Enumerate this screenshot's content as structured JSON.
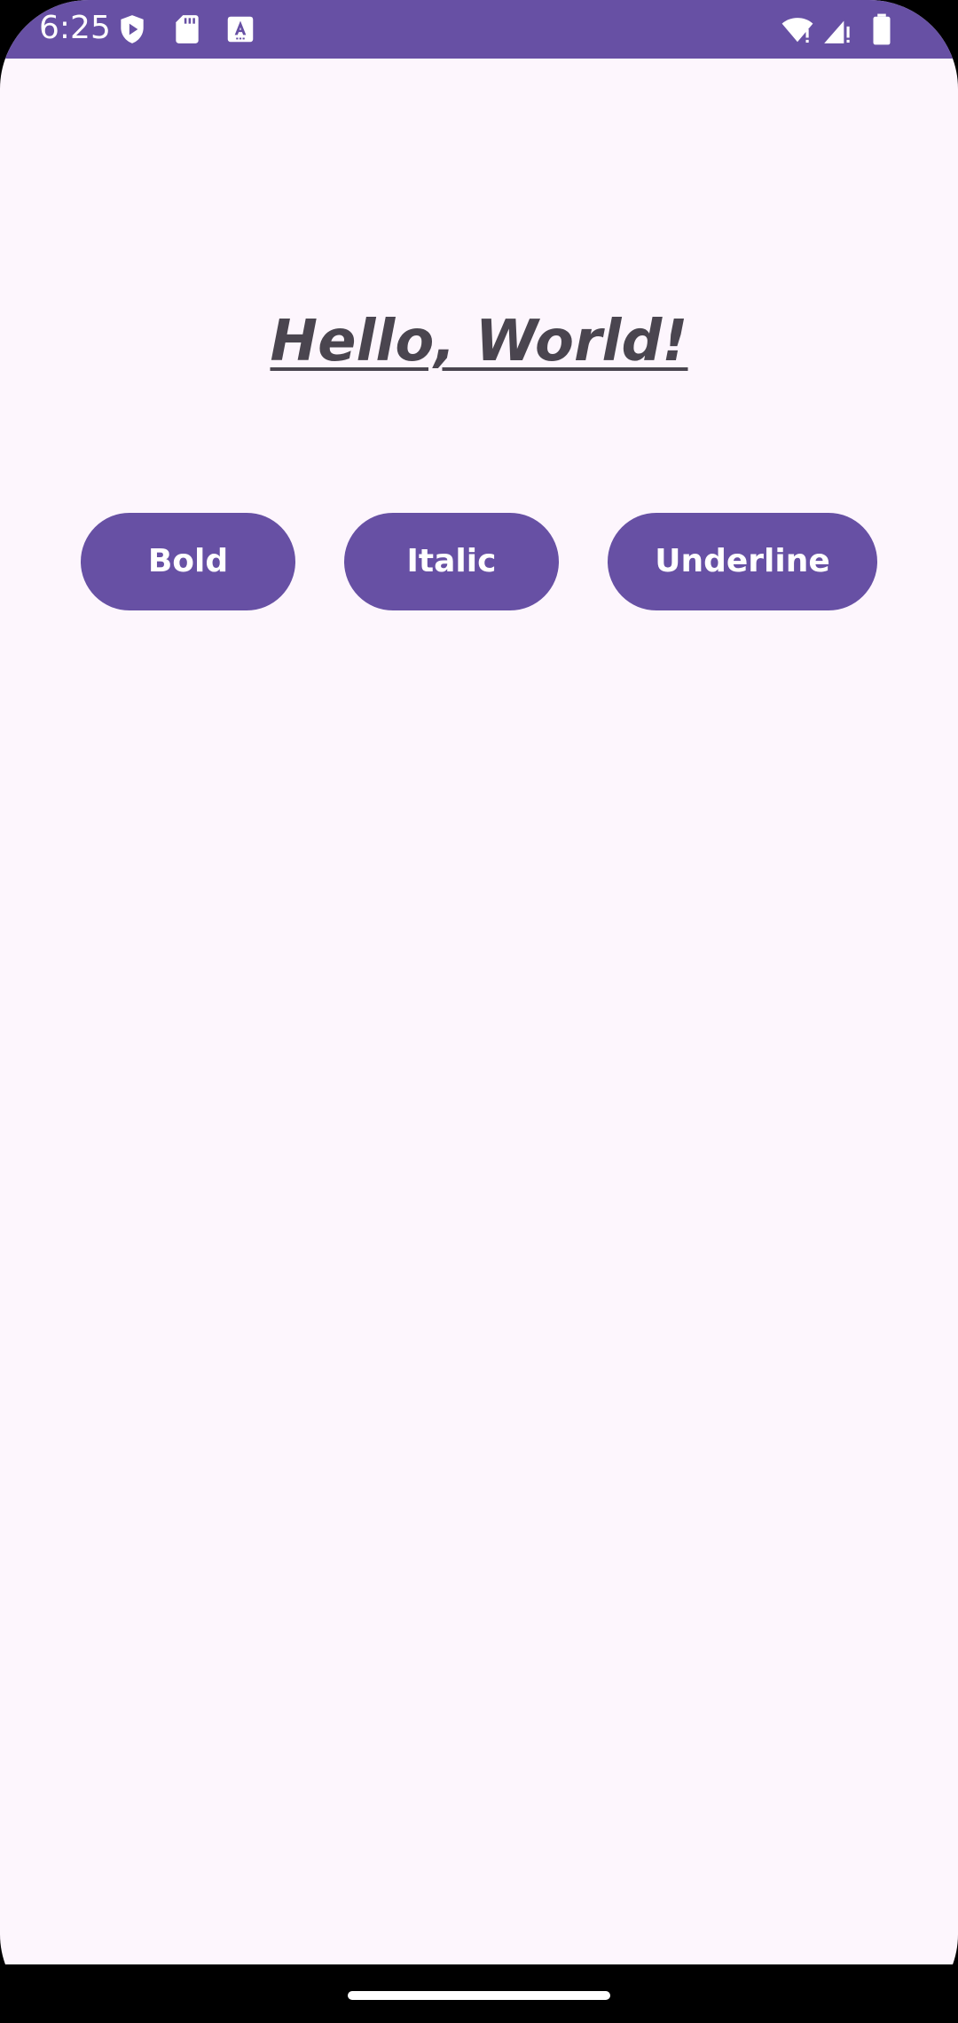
{
  "status_bar": {
    "time": "6:25",
    "icons_left": [
      "play-protect-icon",
      "sd-card-icon",
      "keyboard-a-icon"
    ],
    "icons_right": [
      "wifi-alert-icon",
      "signal-alert-icon",
      "battery-icon"
    ],
    "background": "#6750A4"
  },
  "main": {
    "title": "Hello, World!",
    "title_color": "#4A454F",
    "background": "#FDF6FD"
  },
  "buttons": {
    "bold_label": "Bold",
    "italic_label": "Italic",
    "underline_label": "Underline",
    "color": "#6750A4"
  },
  "navigation": {
    "home_handle": "home-gesture-handle"
  }
}
